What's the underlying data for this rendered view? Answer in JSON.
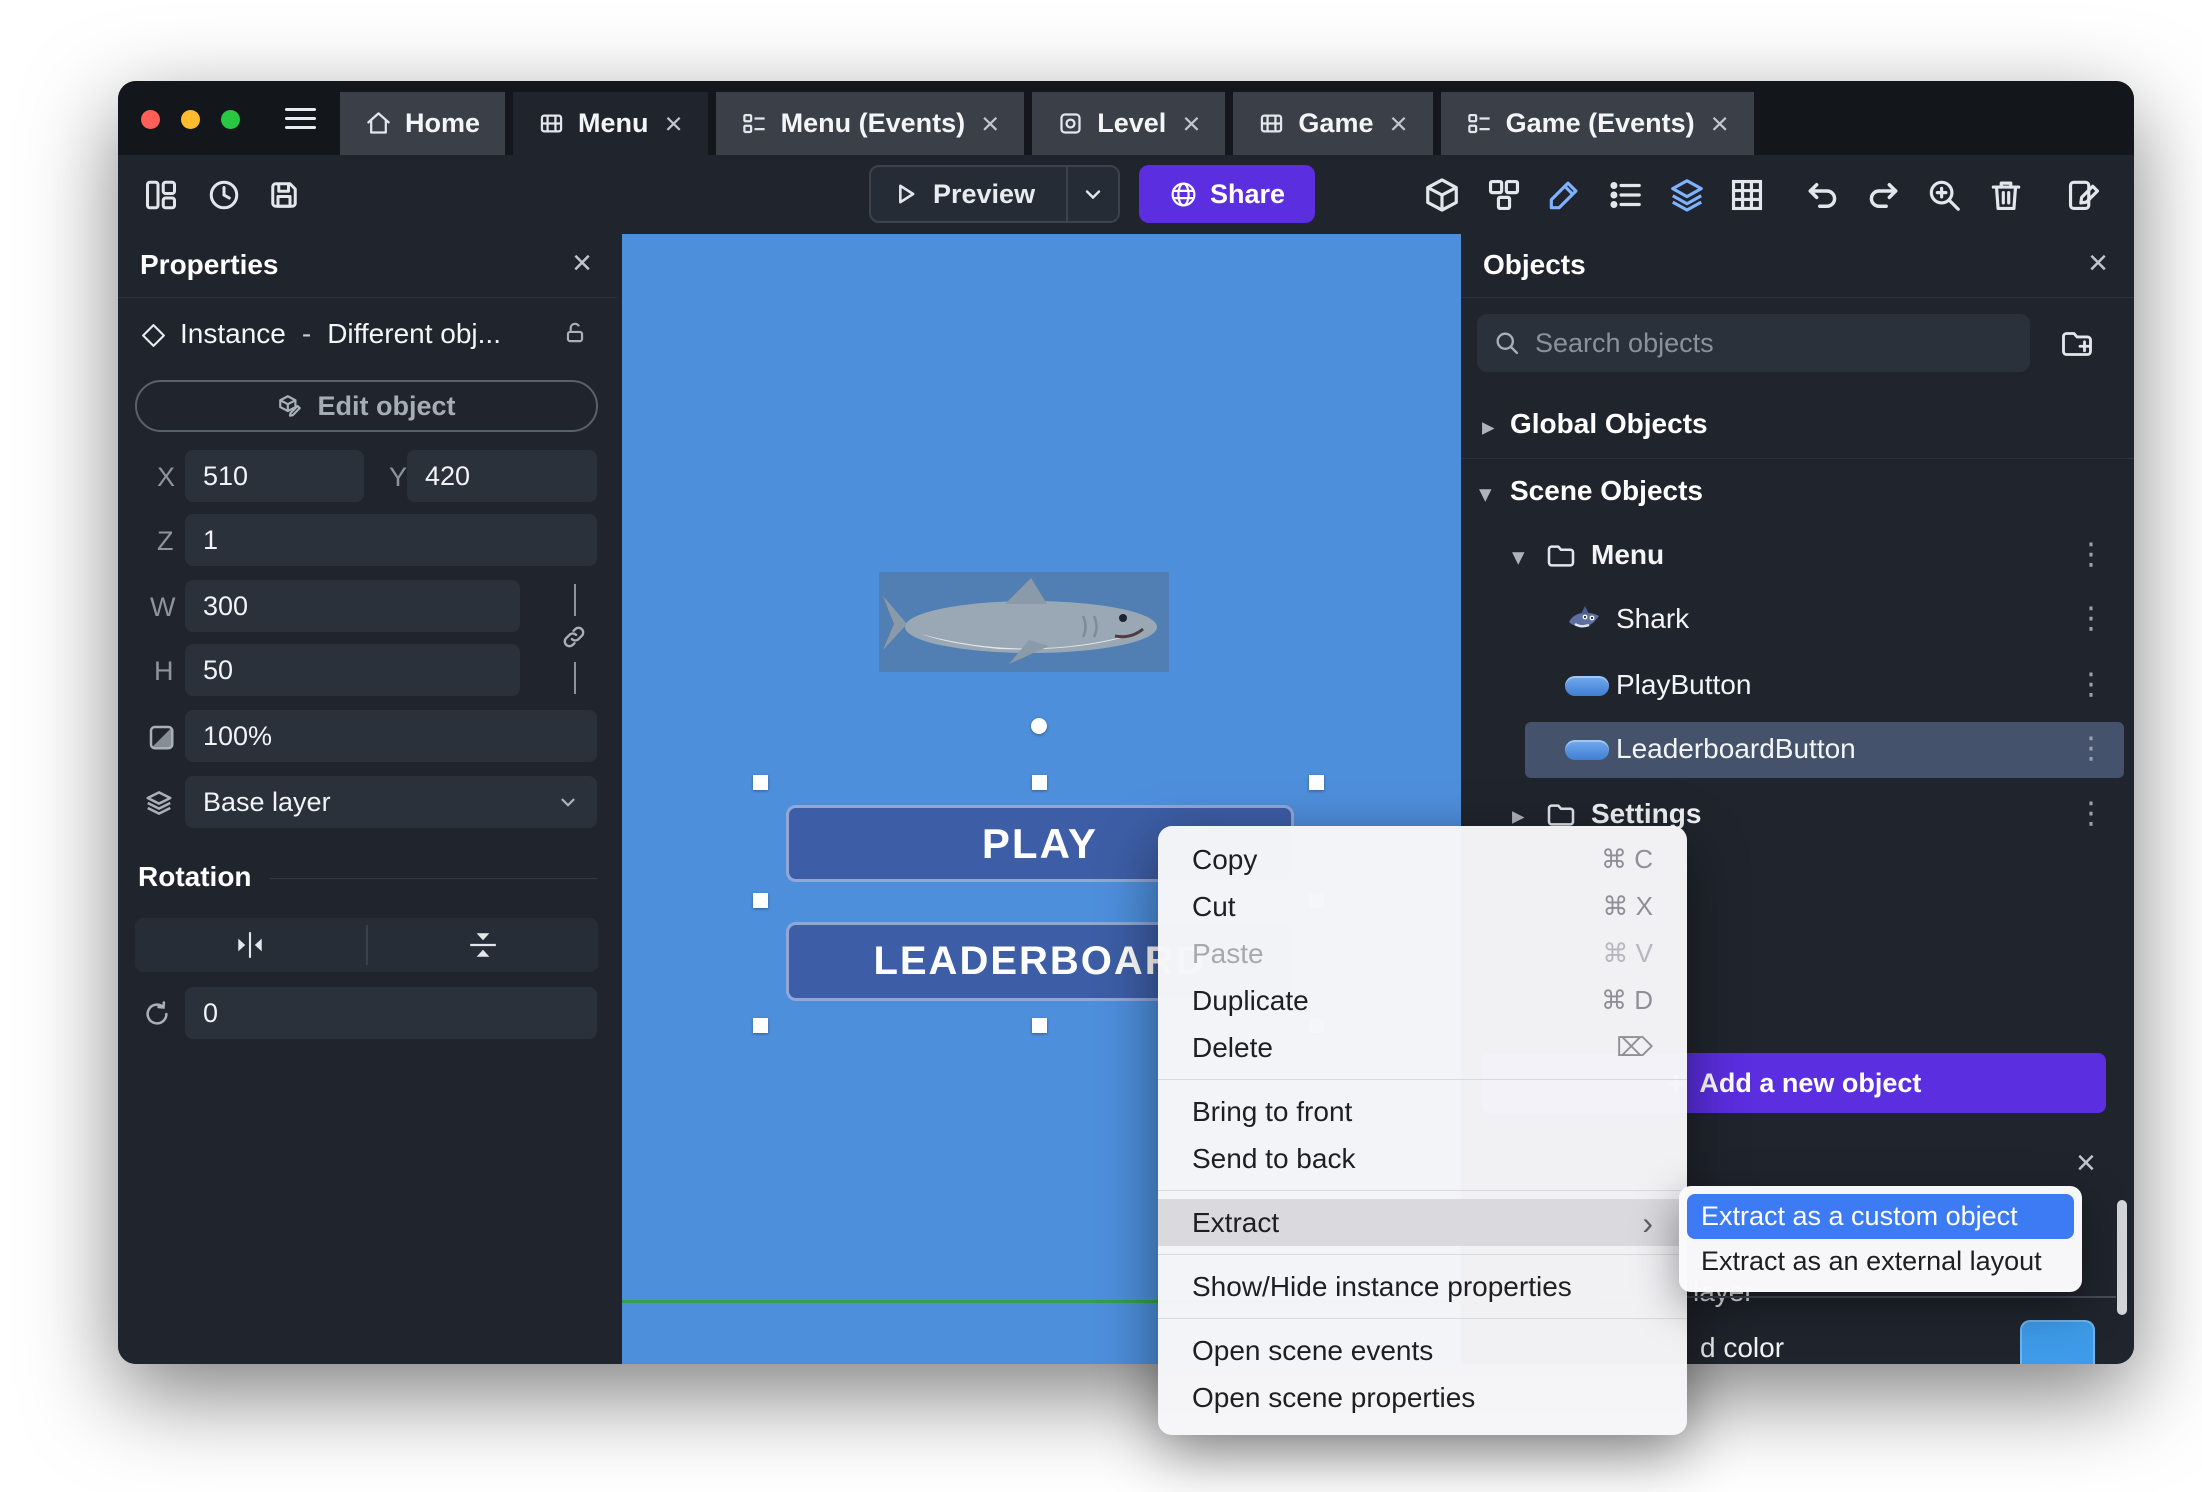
{
  "glyphs": {
    "close": "×",
    "caret_down": "▾",
    "caret_right": "▸",
    "kebab": "⋮",
    "plus": "+",
    "submenu_arrow": "›"
  },
  "titlebar": {
    "tabs": [
      {
        "label": "Home"
      },
      {
        "label": "Menu"
      },
      {
        "label": "Menu (Events)"
      },
      {
        "label": "Level"
      },
      {
        "label": "Game"
      },
      {
        "label": "Game (Events)"
      }
    ]
  },
  "toolbar": {
    "preview": "Preview",
    "share": "Share"
  },
  "properties_panel": {
    "title": "Properties",
    "instance_label": "Instance",
    "separator": "-",
    "instance_object": "Different obj...",
    "edit_object": "Edit object",
    "x_label": "X",
    "x_value": "510",
    "y_label": "Y",
    "y_value": "420",
    "z_label": "Z",
    "z_value": "1",
    "w_label": "W",
    "w_value": "300",
    "h_label": "H",
    "h_value": "50",
    "opacity_value": "100%",
    "layer_value": "Base layer",
    "rotation_title": "Rotation",
    "angle_value": "0"
  },
  "canvas": {
    "play": "PLAY",
    "leaderboard": "LEADERBOARD",
    "background_color": "#4e8fdc"
  },
  "context_menu": {
    "copy": {
      "label": "Copy",
      "shortcut": "⌘ C"
    },
    "cut": {
      "label": "Cut",
      "shortcut": "⌘ X"
    },
    "paste": {
      "label": "Paste",
      "shortcut": "⌘ V"
    },
    "duplicate": {
      "label": "Duplicate",
      "shortcut": "⌘ D"
    },
    "delete": {
      "label": "Delete",
      "shortcut": "⌦"
    },
    "bring_to_front": "Bring to front",
    "send_to_back": "Send to back",
    "extract": "Extract",
    "show_hide": "Show/Hide instance properties",
    "open_scene_events": "Open scene events",
    "open_scene_properties": "Open scene properties"
  },
  "extract_submenu": {
    "custom_object": "Extract as a custom object",
    "external_layout": "Extract as an external layout"
  },
  "objects_panel": {
    "title": "Objects",
    "search_placeholder": "Search objects",
    "global_objects": "Global Objects",
    "scene_objects": "Scene Objects",
    "folder_menu": "Menu",
    "shark": "Shark",
    "play_button": "PlayButton",
    "leaderboard_button": "LeaderboardButton",
    "folder_settings": "Settings",
    "add_new_object": "Add a new object"
  },
  "bottom_panel": {
    "layer_fragment": "layer",
    "color_fragment": "d color",
    "swatch_color": "#3e9be9"
  }
}
